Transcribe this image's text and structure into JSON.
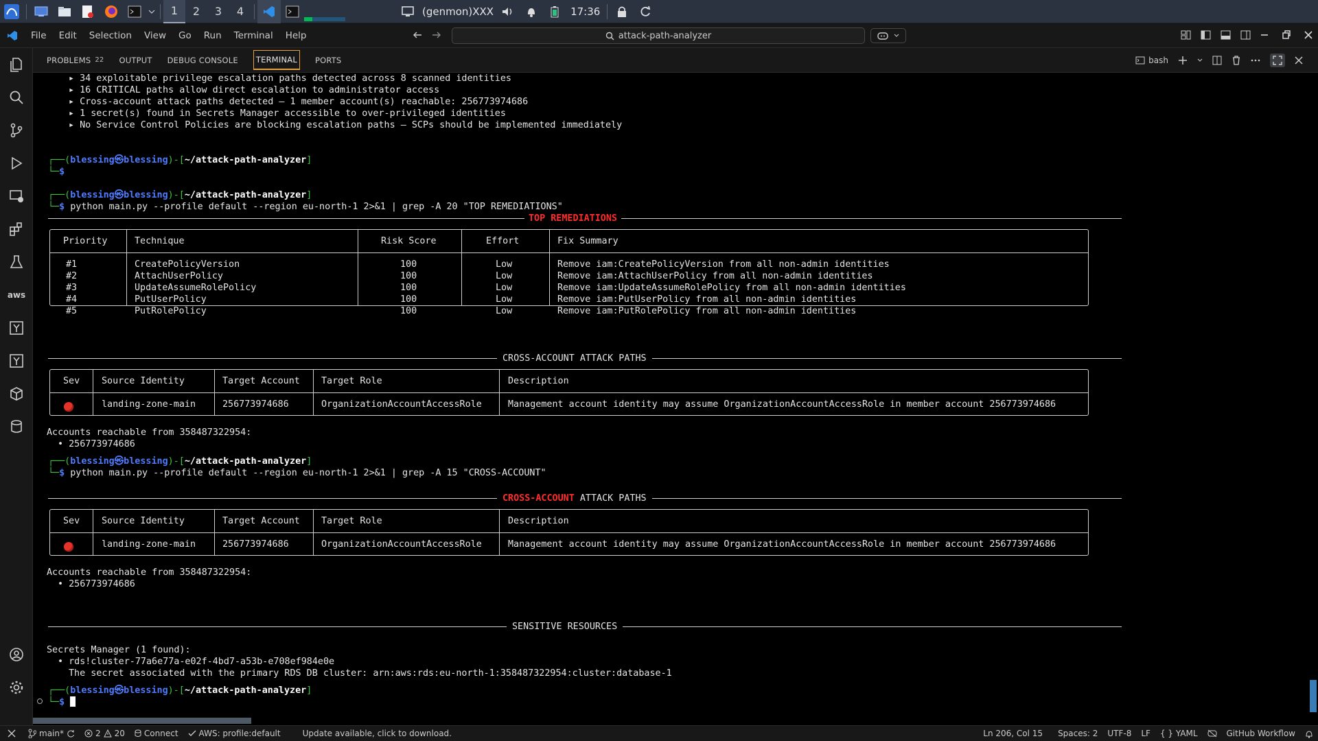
{
  "taskbar": {
    "workspaces": [
      "1",
      "2",
      "3",
      "4"
    ],
    "active_workspace": "1",
    "genmon": "(genmon)XXX",
    "clock": "17:36",
    "icons": [
      "kali-menu-icon",
      "desktop-icon",
      "file-manager-icon",
      "text-editor-icon",
      "firefox-icon",
      "terminal-icon",
      "chevron-down-icon",
      "vscode-icon",
      "terminal-icon",
      "display-icon",
      "volume-icon",
      "bell-icon",
      "battery-icon",
      "lock-icon",
      "refresh-icon"
    ]
  },
  "menubar": {
    "items": [
      "File",
      "Edit",
      "Selection",
      "View",
      "Go",
      "Run",
      "Terminal",
      "Help"
    ],
    "search": "attack-path-analyzer"
  },
  "panel": {
    "tabs": [
      {
        "label": "PROBLEMS",
        "badge": "22"
      },
      {
        "label": "OUTPUT"
      },
      {
        "label": "DEBUG CONSOLE"
      },
      {
        "label": "TERMINAL"
      },
      {
        "label": "PORTS"
      }
    ],
    "active_tab": "TERMINAL",
    "shell": "bash"
  },
  "terminal": {
    "summary": [
      "▸ 34 exploitable privilege escalation paths detected across 8 scanned identities",
      "▸ 16 CRITICAL paths allow direct escalation to administrator access",
      "▸ Cross-account attack paths detected — 1 member account(s) reachable: 256773974686",
      "▸ 1 secret(s) found in Secrets Manager accessible to over-privileged identities",
      "▸ No Service Control Policies are blocking escalation paths — SCPs should be implemented immediately"
    ],
    "prompt": {
      "user": "blessing㉿blessing",
      "dir": "~/attack-path-analyzer",
      "symbol": "$"
    },
    "cmd1": "python main.py --profile default --region eu-north-1 2>&1 | grep -A 20 \"TOP REMEDIATIONS\"",
    "cmd2": "python main.py --profile default --region eu-north-1 2>&1 | grep -A 15 \"CROSS-ACCOUNT\"",
    "remediations": {
      "title": "TOP REMEDIATIONS",
      "headers": [
        "Priority",
        "Technique",
        "Risk Score",
        "Effort",
        "Fix Summary"
      ],
      "rows": [
        [
          "#1",
          "CreatePolicyVersion",
          "100",
          "Low",
          "Remove iam:CreatePolicyVersion from all non-admin identities"
        ],
        [
          "#2",
          "AttachUserPolicy",
          "100",
          "Low",
          "Remove iam:AttachUserPolicy from all non-admin identities"
        ],
        [
          "#3",
          "UpdateAssumeRolePolicy",
          "100",
          "Low",
          "Remove iam:UpdateAssumeRolePolicy from all non-admin identities"
        ],
        [
          "#4",
          "PutUserPolicy",
          "100",
          "Low",
          "Remove iam:PutUserPolicy from all non-admin identities"
        ],
        [
          "#5",
          "PutRolePolicy",
          "100",
          "Low",
          "Remove iam:PutRolePolicy from all non-admin identities"
        ]
      ]
    },
    "cross_account": {
      "title": "CROSS-ACCOUNT ATTACK PATHS",
      "title_a": "CROSS-ACCOUNT",
      "title_b": " ATTACK PATHS",
      "headers": [
        "Sev",
        "Source Identity",
        "Target Account",
        "Target Role",
        "Description"
      ],
      "row": [
        "landing-zone-main",
        "256773974686",
        "OrganizationAccountAccessRole",
        "Management account identity may assume OrganizationAccountAccessRole in member account 256773974686"
      ],
      "reachable_label": "Accounts reachable from 358487322954:",
      "reachable_item": "• 256773974686"
    },
    "sensitive": {
      "title": "SENSITIVE RESOURCES",
      "sm_label": "Secrets Manager (1 found):",
      "secret": "• rds!cluster-77a6e77a-e02f-4bd7-a53b-e708ef984e0e",
      "secret_desc": "The secret associated with the primary RDS DB cluster: arn:aws:rds:eu-north-1:358487322954:cluster:database-1"
    }
  },
  "statusbar": {
    "branch": "main*",
    "errors": "2",
    "warnings": "20",
    "connect": "Connect",
    "aws": "AWS: profile:default",
    "update": "Update available, click to download.",
    "position": "Ln 206, Col 15",
    "spaces": "Spaces: 2",
    "encoding": "UTF-8",
    "eol": "LF",
    "language": "{ } YAML",
    "github": "GitHub Workflow"
  },
  "colors": {
    "prompt_blue": "#4f7cff",
    "prompt_green": "#3ec43e",
    "title_red": "#ff2c2c",
    "accent": "#e8a33d"
  }
}
